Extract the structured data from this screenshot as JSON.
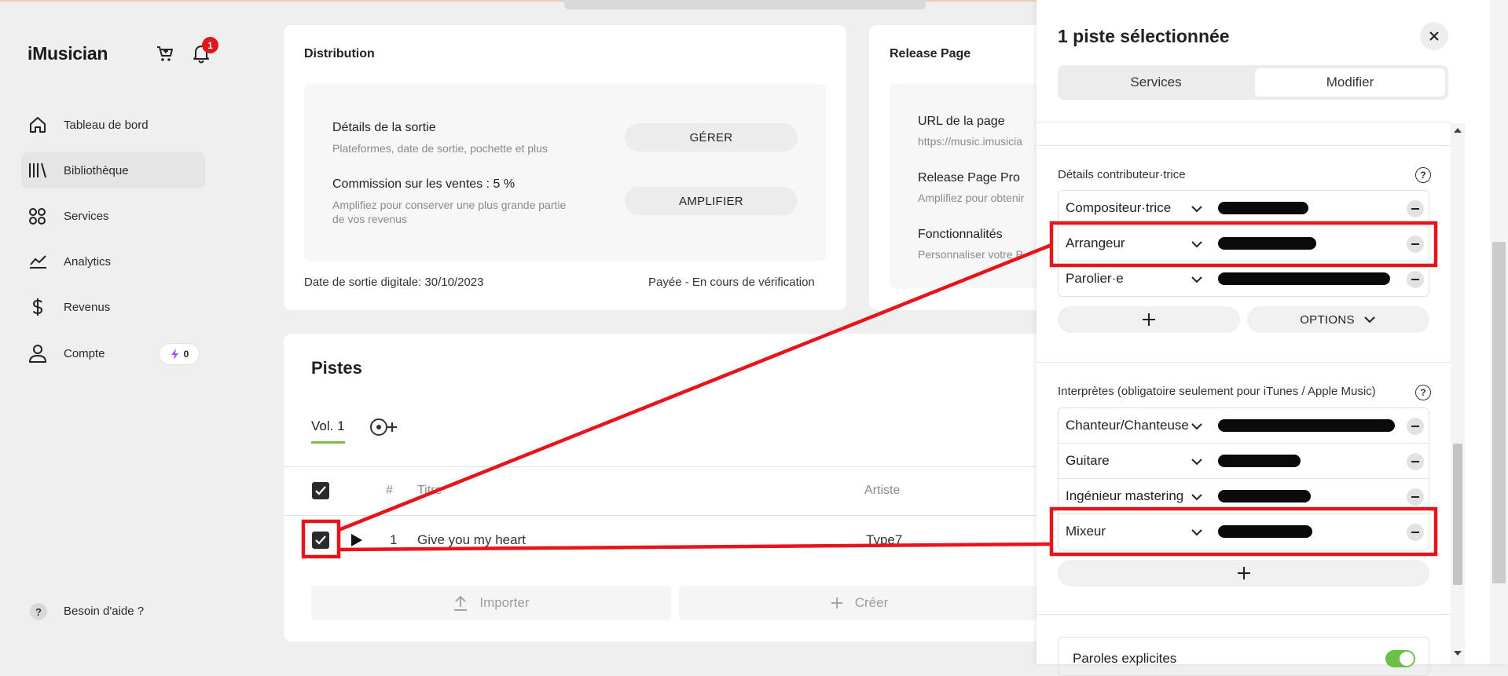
{
  "sidebar": {
    "logo": "iMusician",
    "notification_count": "1",
    "items": [
      {
        "label": "Tableau de bord",
        "icon": "home-icon"
      },
      {
        "label": "Bibliothèque",
        "icon": "library-icon"
      },
      {
        "label": "Services",
        "icon": "services-icon"
      },
      {
        "label": "Analytics",
        "icon": "analytics-icon"
      },
      {
        "label": "Revenus",
        "icon": "dollar-icon"
      },
      {
        "label": "Compte",
        "icon": "user-icon"
      }
    ],
    "credits": "0",
    "help": {
      "icon_text": "?",
      "label": "Besoin d'aide ?"
    }
  },
  "distribution": {
    "title": "Distribution",
    "rows": [
      {
        "title": "Détails de la sortie",
        "subtitle": "Plateformes, date de sortie, pochette et plus",
        "button": "GÉRER"
      },
      {
        "title": "Commission sur les ventes : 5 %",
        "subtitle_line1": "Amplifiez pour conserver une plus grande partie",
        "subtitle_line2": "de vos revenus",
        "button": "AMPLIFIER"
      }
    ],
    "release_date": "Date de sortie digitale: 30/10/2023",
    "status": "Payée - En cours de vérification"
  },
  "release_page": {
    "title": "Release Page",
    "rows": [
      {
        "title": "URL de la page",
        "subtitle": "https://music.imusicia"
      },
      {
        "title": "Release Page Pro",
        "subtitle": "Amplifiez pour obtenir"
      },
      {
        "title": "Fonctionnalités",
        "subtitle": "Personnaliser votre P"
      }
    ]
  },
  "tracks": {
    "title": "Pistes",
    "tabs": [
      {
        "label": "Vol. 1"
      }
    ],
    "columns": {
      "number": "#",
      "title": "Titre",
      "artist": "Artiste"
    },
    "rows": [
      {
        "number": "1",
        "title": "Give you my heart",
        "artist": "Type7"
      }
    ],
    "import_label": "Importer",
    "create_label": "Créer"
  },
  "panel": {
    "title": "1 piste sélectionnée",
    "tabs": [
      {
        "label": "Services"
      },
      {
        "label": "Modifier",
        "active": true
      }
    ],
    "contributors": {
      "label": "Détails contributeur·trice",
      "roles": [
        {
          "role": "Compositeur·trice"
        },
        {
          "role": "Arrangeur"
        },
        {
          "role": "Parolier·e"
        }
      ],
      "options_label": "OPTIONS"
    },
    "performers": {
      "label": "Interprètes (obligatoire seulement pour iTunes / Apple Music)",
      "roles": [
        {
          "role": "Chanteur/Chanteuse"
        },
        {
          "role": "Guitare"
        },
        {
          "role": "Ingénieur mastering"
        },
        {
          "role": "Mixeur"
        }
      ]
    },
    "explicit": {
      "label": "Paroles explicites",
      "on": true
    }
  },
  "colors": {
    "accent_green": "#6cc04a",
    "badge_red": "#e3141a",
    "annotation_red": "#e8141a"
  }
}
